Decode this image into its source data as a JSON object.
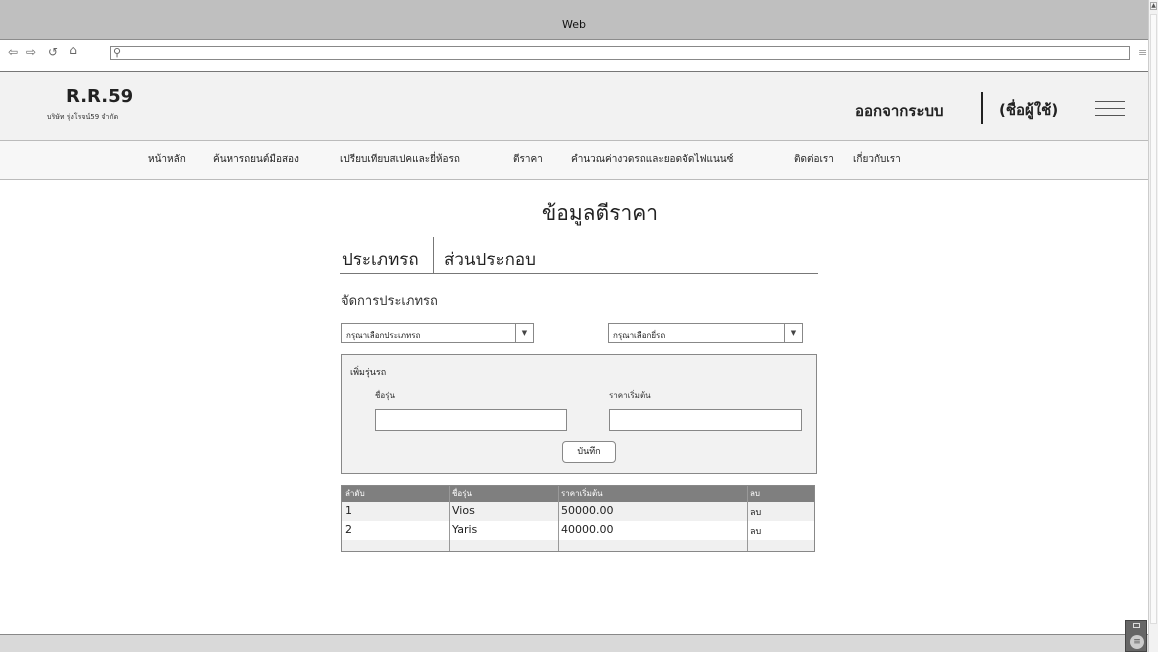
{
  "window": {
    "title": "Web"
  },
  "browser": {
    "back_icon": "back-arrow-icon",
    "forward_icon": "forward-arrow-icon",
    "reload_icon": "reload-icon",
    "home_icon": "home-icon",
    "search_icon": "search-icon",
    "url_value": ""
  },
  "header": {
    "logo": "R.R.59",
    "company": "บริษัท รุ่งโรจน์59 จำกัด",
    "logout": "ออกจากระบบ",
    "username": "(ชื่อผู้ใช้)"
  },
  "nav": {
    "items": [
      {
        "label": "หน้าหลัก"
      },
      {
        "label": "ค้นหารถยนต์มือสอง"
      },
      {
        "label": "เปรียบเทียบสเปคและยี่ห้อรถ"
      },
      {
        "label": "ตีราคา"
      },
      {
        "label": "คำนวณค่างวดรถและยอดจัดไฟแนนซ์"
      },
      {
        "label": "ติดต่อเรา"
      },
      {
        "label": "เกี่ยวกับเรา"
      }
    ]
  },
  "main": {
    "title": "ข้อมูลตีราคา",
    "tabs": [
      {
        "label": "ประเภทรถ"
      },
      {
        "label": "ส่วนประกอบ"
      }
    ],
    "section_label": "จัดการประเภทรถ",
    "select_type": {
      "value": "กรุณาเลือกประเภทรถ"
    },
    "select_brand": {
      "value": "กรุณาเลือกยี่รถ"
    },
    "form": {
      "legend": "เพิ่มรุ่นรถ",
      "model_label": "ชื่อรุ่น",
      "price_label": "ราคาเริ่มต้น",
      "model_value": "",
      "price_value": "",
      "save_label": "บันทึก"
    },
    "table": {
      "headers": [
        "ลำดับ",
        "ชื่อรุ่น",
        "ราคาเริ่มต้น",
        "ลบ"
      ],
      "rows": [
        [
          "1",
          "Vios",
          "50000.00",
          "ลบ"
        ],
        [
          "2",
          "Yaris",
          "40000.00",
          "ลบ"
        ]
      ]
    }
  }
}
